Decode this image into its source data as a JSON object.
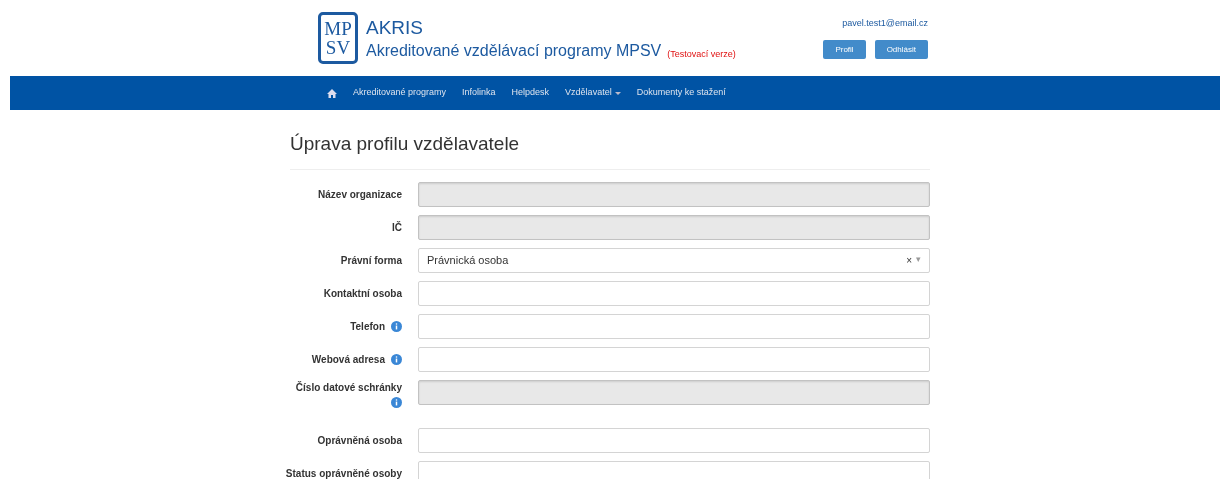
{
  "header": {
    "logo_top": "MP",
    "logo_bottom": "SV",
    "title": "AKRIS",
    "subtitle": "Akreditované vzdělávací programy MPSV",
    "badge": "(Testovací verze)",
    "user_email": "pavel.test1@email.cz",
    "buttons": [
      "Profil",
      "Odhlásit"
    ]
  },
  "nav": {
    "items": [
      {
        "label": "Akreditované programy",
        "dropdown": false
      },
      {
        "label": "Infolinka",
        "dropdown": false
      },
      {
        "label": "Helpdesk",
        "dropdown": false
      },
      {
        "label": "Vzdělavatel",
        "dropdown": true
      },
      {
        "label": "Dokumenty ke stažení",
        "dropdown": false
      }
    ]
  },
  "page_title": "Úprava profilu vzdělavatele",
  "form": [
    {
      "label": "Název organizace",
      "kind": "text",
      "disabled": true,
      "info": false
    },
    {
      "label": "IČ",
      "kind": "text",
      "disabled": true,
      "info": false
    },
    {
      "label": "Právní forma",
      "kind": "select",
      "disabled": false,
      "info": false,
      "value": "Právnická osoba",
      "clear": "×",
      "caret": "▾"
    },
    {
      "label": "Kontaktní osoba",
      "kind": "text",
      "disabled": false,
      "info": false
    },
    {
      "label": "Telefon",
      "kind": "text",
      "disabled": false,
      "info": true
    },
    {
      "label": "Webová adresa",
      "kind": "text",
      "disabled": false,
      "info": true
    },
    {
      "label": "Číslo datové schránky",
      "kind": "text",
      "disabled": true,
      "info": true
    },
    {
      "label": "Oprávněná osoba",
      "kind": "text",
      "disabled": false,
      "info": false
    },
    {
      "label": "Status oprávněné osoby",
      "kind": "text",
      "disabled": false,
      "info": false
    }
  ]
}
